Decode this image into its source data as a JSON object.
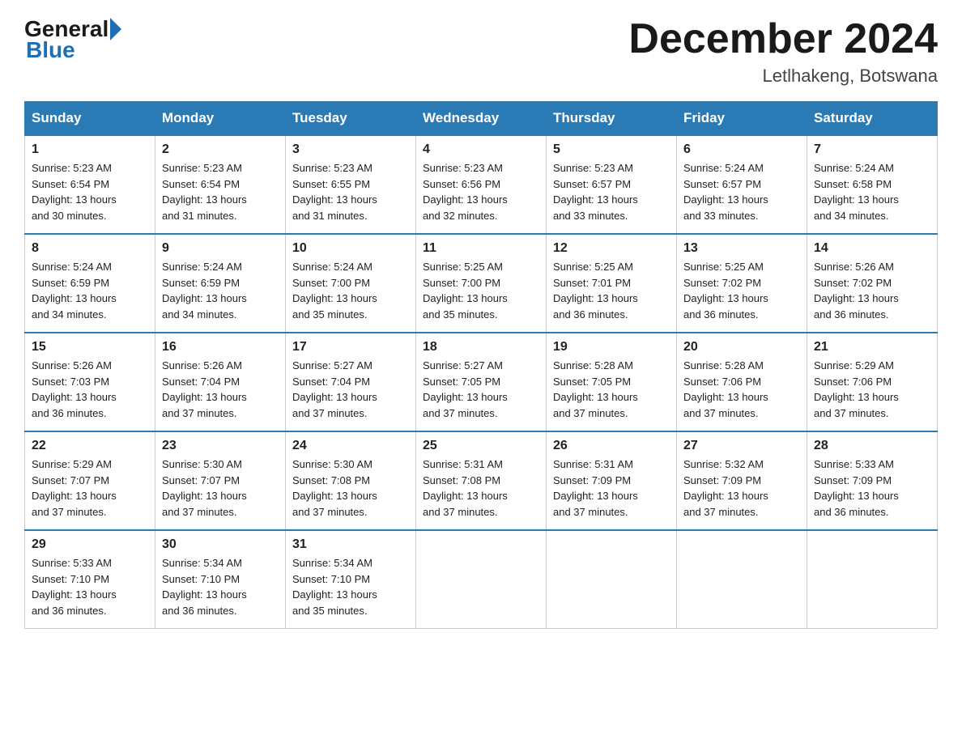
{
  "logo": {
    "general": "General",
    "blue": "Blue"
  },
  "header": {
    "month": "December 2024",
    "location": "Letlhakeng, Botswana"
  },
  "days_of_week": [
    "Sunday",
    "Monday",
    "Tuesday",
    "Wednesday",
    "Thursday",
    "Friday",
    "Saturday"
  ],
  "weeks": [
    [
      {
        "day": "1",
        "sunrise": "5:23 AM",
        "sunset": "6:54 PM",
        "daylight": "13 hours and 30 minutes."
      },
      {
        "day": "2",
        "sunrise": "5:23 AM",
        "sunset": "6:54 PM",
        "daylight": "13 hours and 31 minutes."
      },
      {
        "day": "3",
        "sunrise": "5:23 AM",
        "sunset": "6:55 PM",
        "daylight": "13 hours and 31 minutes."
      },
      {
        "day": "4",
        "sunrise": "5:23 AM",
        "sunset": "6:56 PM",
        "daylight": "13 hours and 32 minutes."
      },
      {
        "day": "5",
        "sunrise": "5:23 AM",
        "sunset": "6:57 PM",
        "daylight": "13 hours and 33 minutes."
      },
      {
        "day": "6",
        "sunrise": "5:24 AM",
        "sunset": "6:57 PM",
        "daylight": "13 hours and 33 minutes."
      },
      {
        "day": "7",
        "sunrise": "5:24 AM",
        "sunset": "6:58 PM",
        "daylight": "13 hours and 34 minutes."
      }
    ],
    [
      {
        "day": "8",
        "sunrise": "5:24 AM",
        "sunset": "6:59 PM",
        "daylight": "13 hours and 34 minutes."
      },
      {
        "day": "9",
        "sunrise": "5:24 AM",
        "sunset": "6:59 PM",
        "daylight": "13 hours and 34 minutes."
      },
      {
        "day": "10",
        "sunrise": "5:24 AM",
        "sunset": "7:00 PM",
        "daylight": "13 hours and 35 minutes."
      },
      {
        "day": "11",
        "sunrise": "5:25 AM",
        "sunset": "7:00 PM",
        "daylight": "13 hours and 35 minutes."
      },
      {
        "day": "12",
        "sunrise": "5:25 AM",
        "sunset": "7:01 PM",
        "daylight": "13 hours and 36 minutes."
      },
      {
        "day": "13",
        "sunrise": "5:25 AM",
        "sunset": "7:02 PM",
        "daylight": "13 hours and 36 minutes."
      },
      {
        "day": "14",
        "sunrise": "5:26 AM",
        "sunset": "7:02 PM",
        "daylight": "13 hours and 36 minutes."
      }
    ],
    [
      {
        "day": "15",
        "sunrise": "5:26 AM",
        "sunset": "7:03 PM",
        "daylight": "13 hours and 36 minutes."
      },
      {
        "day": "16",
        "sunrise": "5:26 AM",
        "sunset": "7:04 PM",
        "daylight": "13 hours and 37 minutes."
      },
      {
        "day": "17",
        "sunrise": "5:27 AM",
        "sunset": "7:04 PM",
        "daylight": "13 hours and 37 minutes."
      },
      {
        "day": "18",
        "sunrise": "5:27 AM",
        "sunset": "7:05 PM",
        "daylight": "13 hours and 37 minutes."
      },
      {
        "day": "19",
        "sunrise": "5:28 AM",
        "sunset": "7:05 PM",
        "daylight": "13 hours and 37 minutes."
      },
      {
        "day": "20",
        "sunrise": "5:28 AM",
        "sunset": "7:06 PM",
        "daylight": "13 hours and 37 minutes."
      },
      {
        "day": "21",
        "sunrise": "5:29 AM",
        "sunset": "7:06 PM",
        "daylight": "13 hours and 37 minutes."
      }
    ],
    [
      {
        "day": "22",
        "sunrise": "5:29 AM",
        "sunset": "7:07 PM",
        "daylight": "13 hours and 37 minutes."
      },
      {
        "day": "23",
        "sunrise": "5:30 AM",
        "sunset": "7:07 PM",
        "daylight": "13 hours and 37 minutes."
      },
      {
        "day": "24",
        "sunrise": "5:30 AM",
        "sunset": "7:08 PM",
        "daylight": "13 hours and 37 minutes."
      },
      {
        "day": "25",
        "sunrise": "5:31 AM",
        "sunset": "7:08 PM",
        "daylight": "13 hours and 37 minutes."
      },
      {
        "day": "26",
        "sunrise": "5:31 AM",
        "sunset": "7:09 PM",
        "daylight": "13 hours and 37 minutes."
      },
      {
        "day": "27",
        "sunrise": "5:32 AM",
        "sunset": "7:09 PM",
        "daylight": "13 hours and 37 minutes."
      },
      {
        "day": "28",
        "sunrise": "5:33 AM",
        "sunset": "7:09 PM",
        "daylight": "13 hours and 36 minutes."
      }
    ],
    [
      {
        "day": "29",
        "sunrise": "5:33 AM",
        "sunset": "7:10 PM",
        "daylight": "13 hours and 36 minutes."
      },
      {
        "day": "30",
        "sunrise": "5:34 AM",
        "sunset": "7:10 PM",
        "daylight": "13 hours and 36 minutes."
      },
      {
        "day": "31",
        "sunrise": "5:34 AM",
        "sunset": "7:10 PM",
        "daylight": "13 hours and 35 minutes."
      },
      null,
      null,
      null,
      null
    ]
  ],
  "labels": {
    "sunrise": "Sunrise:",
    "sunset": "Sunset:",
    "daylight": "Daylight:"
  }
}
